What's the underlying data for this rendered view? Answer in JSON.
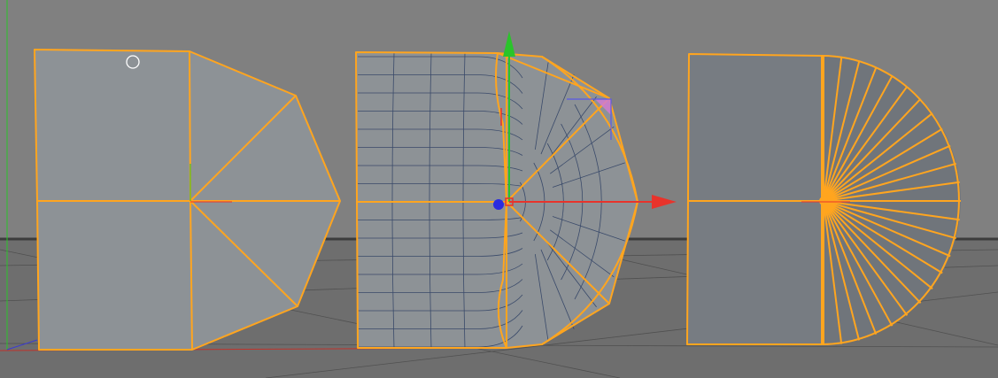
{
  "viewport": {
    "background_color": "#808080",
    "floor_color": "#6e6e6e",
    "horizon_color": "#3c3c3c",
    "grid_line_color": "#505050"
  },
  "selection": {
    "edge_color": "#ffa51f",
    "face_color": "#8d9296",
    "face_color_dark": "#70757b",
    "subdivision_line_color": "#3a4a6a"
  },
  "gizmo": {
    "x_axis_color": "#e8332b",
    "y_axis_color": "#2ac42a",
    "z_handle_color": "#2b2bdf",
    "plane_handle_color": "#d17bd1",
    "plane_outline_color": "#5a5ae6"
  },
  "cursor": {
    "icon": "circle-cursor-icon"
  },
  "objects": [
    {
      "name": "polygon-object-1",
      "topology": "quad-and-triangle-fan"
    },
    {
      "name": "polygon-object-2",
      "topology": "subdivided-grid"
    },
    {
      "name": "polygon-object-3",
      "topology": "half-disc-fan"
    }
  ]
}
